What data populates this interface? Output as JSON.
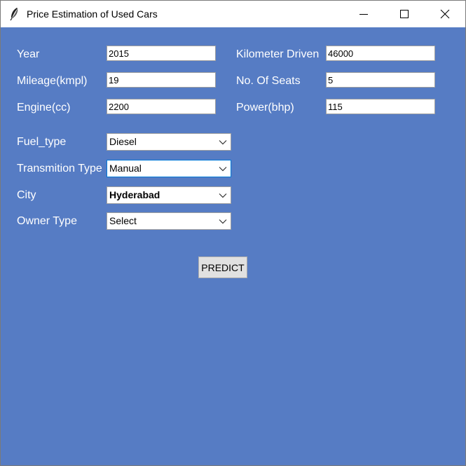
{
  "window": {
    "title": "Price Estimation of Used Cars",
    "icon": "feather-icon",
    "background": "#567cc4"
  },
  "controls": {
    "minimize_icon": "minimize-icon",
    "maximize_icon": "maximize-icon",
    "close_icon": "close-icon"
  },
  "fields": {
    "year": {
      "label": "Year",
      "value": "2015"
    },
    "kilometer": {
      "label": "Kilometer Driven",
      "value": "46000"
    },
    "mileage": {
      "label": "Mileage(kmpl)",
      "value": "19"
    },
    "seats": {
      "label": "No. Of Seats",
      "value": "5"
    },
    "engine": {
      "label": "Engine(cc)",
      "value": "2200"
    },
    "power": {
      "label": "Power(bhp)",
      "value": "115"
    }
  },
  "dropdowns": {
    "fuel_type": {
      "label": "Fuel_type",
      "selected": "Diesel"
    },
    "transmission": {
      "label": "Transmition Type",
      "selected": "Manual"
    },
    "city": {
      "label": "City",
      "selected": "Hyderabad"
    },
    "owner_type": {
      "label": "Owner Type",
      "selected": "Select"
    }
  },
  "actions": {
    "predict_label": "PREDICT"
  }
}
